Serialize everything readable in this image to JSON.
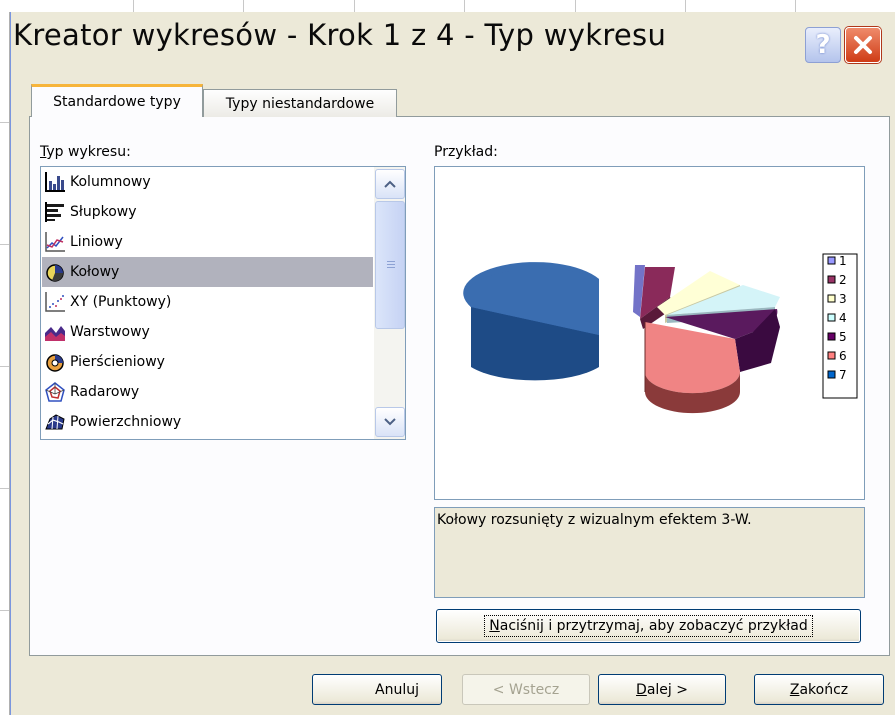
{
  "dialog": {
    "title": "Kreator wykresów - Krok 1 z 4 - Typ wykresu",
    "help_glyph": "?",
    "close_glyph": "✕"
  },
  "tabs": [
    {
      "label": "Standardowe typy",
      "active": true
    },
    {
      "label": "Typy niestandardowe",
      "active": false
    }
  ],
  "chart_type_list": {
    "label_mnemonic": "T",
    "label_rest": "yp wykresu:",
    "selected": "Kołowy",
    "items": [
      {
        "label": "Kolumnowy",
        "icon": "column-chart-icon"
      },
      {
        "label": "Słupkowy",
        "icon": "bar-chart-icon"
      },
      {
        "label": "Liniowy",
        "icon": "line-chart-icon"
      },
      {
        "label": "Kołowy",
        "icon": "pie-chart-icon"
      },
      {
        "label": "XY (Punktowy)",
        "icon": "scatter-chart-icon"
      },
      {
        "label": "Warstwowy",
        "icon": "area-chart-icon"
      },
      {
        "label": "Pierścieniowy",
        "icon": "doughnut-chart-icon"
      },
      {
        "label": "Radarowy",
        "icon": "radar-chart-icon"
      },
      {
        "label": "Powierzchniowy",
        "icon": "surface-chart-icon"
      }
    ]
  },
  "preview": {
    "label": "Przykład:",
    "legend": [
      "1",
      "2",
      "3",
      "4",
      "5",
      "6",
      "7"
    ],
    "slice_colors": [
      "#9999ff",
      "#993366",
      "#ffffcc",
      "#ccffff",
      "#660066",
      "#ff8080",
      "#0066cc"
    ]
  },
  "description": "Kołowy rozsunięty z wizualnym efektem 3-W.",
  "preview_button": {
    "mnemonic": "N",
    "rest": "aciśnij i przytrzymaj, aby zobaczyć przykład"
  },
  "buttons": {
    "cancel": "Anuluj",
    "back": "< Wstecz",
    "next_mnemonic": "D",
    "next_rest": "alej >",
    "finish_mnemonic": "Z",
    "finish_rest": "akończ"
  }
}
